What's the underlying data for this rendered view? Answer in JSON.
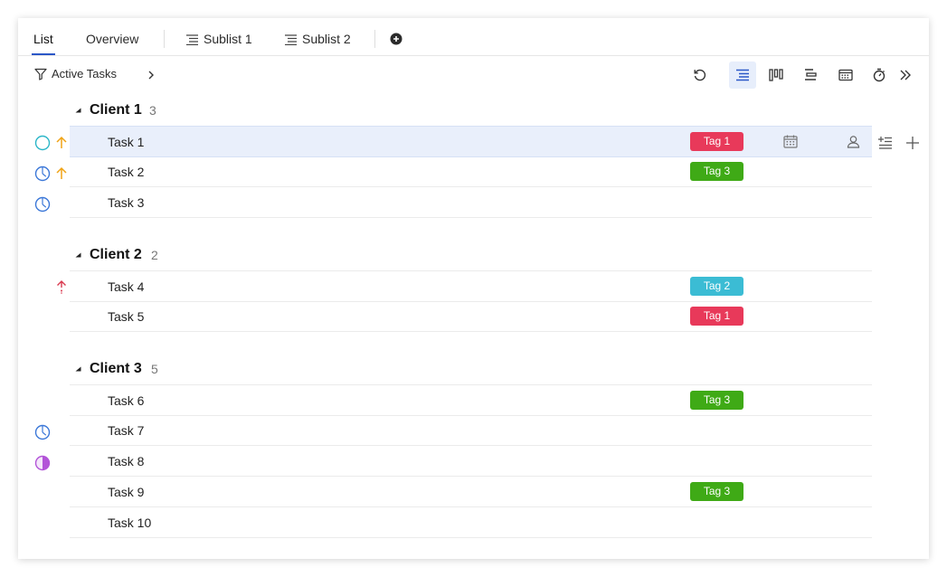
{
  "colors": {
    "accent": "#2a57c7",
    "tag_red": "#e8395a",
    "tag_green": "#3faa16",
    "tag_cyan": "#3bbcd4",
    "priority_orange": "#f0a417",
    "priority_red": "#d93a50",
    "status_teal": "#2bb6c8",
    "status_blue": "#3c78d8",
    "status_purple": "#b354d8"
  },
  "tabs": [
    {
      "label": "List",
      "active": true
    },
    {
      "label": "Overview"
    },
    {
      "label": "Sublist 1",
      "icon": "sublist-icon"
    },
    {
      "label": "Sublist 2",
      "icon": "sublist-icon"
    }
  ],
  "add_tab_icon": "plus-circle-icon",
  "filter": {
    "label": "Active Tasks",
    "icon": "funnel-icon",
    "expand_icon": "chevron-right-icon"
  },
  "toolbar_icons": [
    "refresh-icon",
    "list-view-icon",
    "board-view-icon",
    "gantt-view-icon",
    "calendar-view-icon",
    "timer-icon",
    "double-chevron-right-icon"
  ],
  "groups": [
    {
      "name": "Client 1",
      "count": "3"
    },
    {
      "name": "Client 2",
      "count": "2"
    },
    {
      "name": "Client 3",
      "count": "5"
    }
  ],
  "tasks": [
    {
      "name": "Task 1",
      "tag": "Tag 1",
      "status": "open",
      "priority": "up-orange"
    },
    {
      "name": "Task 2",
      "tag": "Tag 3",
      "status": "in-progress",
      "priority": "up-orange"
    },
    {
      "name": "Task 3",
      "tag": "",
      "status": "in-progress",
      "priority": ""
    },
    {
      "name": "Task 4",
      "tag": "Tag 2",
      "status": "",
      "priority": "up-red"
    },
    {
      "name": "Task 5",
      "tag": "Tag 1",
      "status": "",
      "priority": ""
    },
    {
      "name": "Task 6",
      "tag": "Tag 3",
      "status": "",
      "priority": ""
    },
    {
      "name": "Task 7",
      "tag": "",
      "status": "in-progress",
      "priority": ""
    },
    {
      "name": "Task 8",
      "tag": "",
      "status": "half-done",
      "priority": ""
    },
    {
      "name": "Task 9",
      "tag": "Tag 3",
      "status": "",
      "priority": ""
    },
    {
      "name": "Task 10",
      "tag": "",
      "status": "",
      "priority": ""
    }
  ],
  "row_hover_icons": [
    "calendar-icon",
    "assignee-icon",
    "add-subtask-icon",
    "plus-icon"
  ]
}
